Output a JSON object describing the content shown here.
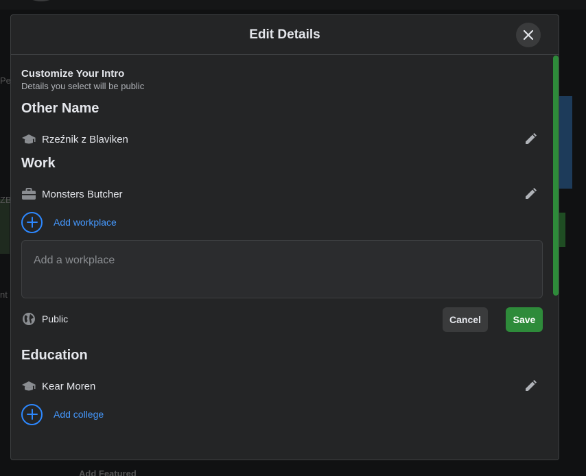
{
  "modal": {
    "title": "Edit Details"
  },
  "intro": {
    "title": "Customize Your Intro",
    "subtitle": "Details you select will be public"
  },
  "other_name": {
    "heading": "Other Name",
    "value": "Rzeźnik z Blaviken"
  },
  "work": {
    "heading": "Work",
    "value": "Monsters Butcher",
    "add_label": "Add workplace",
    "input_placeholder": "Add a workplace",
    "input_value": "",
    "privacy_label": "Public",
    "cancel_label": "Cancel",
    "save_label": "Save"
  },
  "education": {
    "heading": "Education",
    "value": "Kear Moren",
    "add_label": "Add college"
  },
  "background": {
    "footer_text": "Add Featured",
    "left_fragment_1": "Pe",
    "left_fragment_2": "ZB",
    "left_fragment_3": "nt"
  },
  "colors": {
    "accent_blue": "#2d88ff",
    "save_green": "#2e8b3a",
    "surface": "#242526"
  }
}
